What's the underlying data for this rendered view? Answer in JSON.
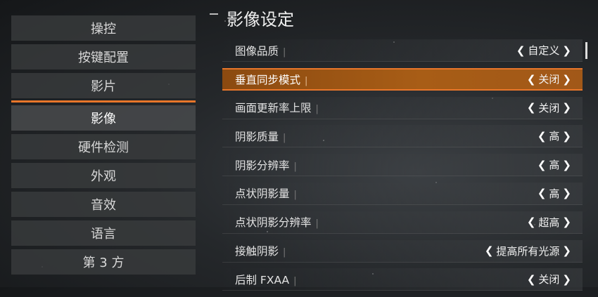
{
  "left_menu": {
    "items": [
      {
        "label": "操控"
      },
      {
        "label": "按键配置"
      },
      {
        "label": "影片"
      },
      {
        "label": "影像"
      },
      {
        "label": "硬件检测"
      },
      {
        "label": "外观"
      },
      {
        "label": "音效"
      },
      {
        "label": "语言"
      },
      {
        "label": "第 3 方"
      }
    ],
    "active_index": 3
  },
  "section_title": "影像设定",
  "arrows": {
    "left": "❮",
    "right": "❯"
  },
  "settings": [
    {
      "label": "图像品质",
      "value": "自定义"
    },
    {
      "label": "垂直同步模式",
      "value": "关闭",
      "selected": true
    },
    {
      "label": "画面更新率上限",
      "value": "关闭"
    },
    {
      "label": "阴影质量",
      "value": "高"
    },
    {
      "label": "阴影分辨率",
      "value": "高"
    },
    {
      "label": "点状阴影量",
      "value": "高"
    },
    {
      "label": "点状阴影分辨率",
      "value": "超高"
    },
    {
      "label": "接触阴影",
      "value": "提高所有光源"
    },
    {
      "label": "后制 FXAA",
      "value": "关闭"
    }
  ],
  "colors": {
    "accent": "#e8762a",
    "selected_row": "#a85d16"
  }
}
